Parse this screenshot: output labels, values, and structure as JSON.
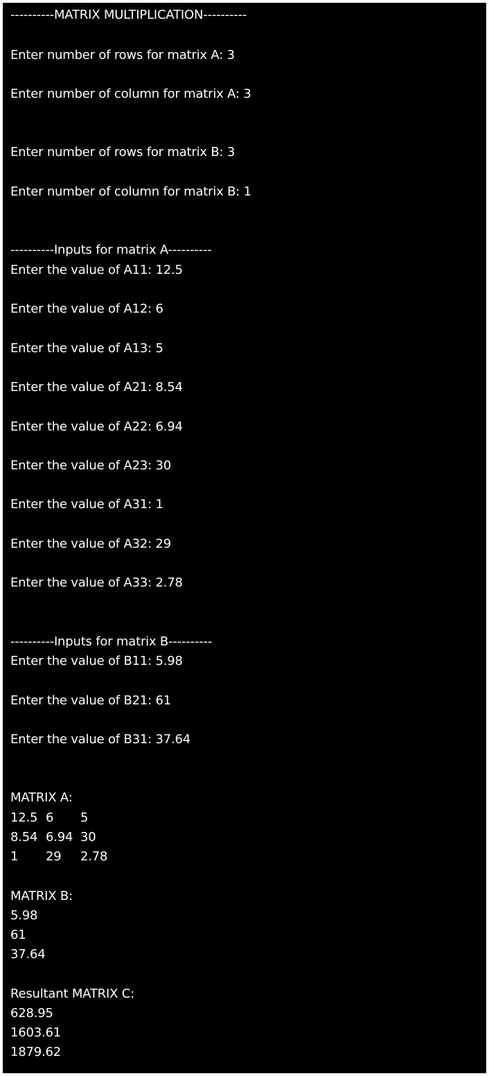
{
  "header": "----------MATRIX MULTIPLICATION----------",
  "prompts": {
    "rows_a": "Enter number of rows for matrix A: 3",
    "cols_a": "Enter number of column for matrix A: 3",
    "rows_b": "Enter number of rows for matrix B: 3",
    "cols_b": "Enter number of column for matrix B: 1"
  },
  "inputs_a": {
    "header": "----------Inputs for matrix A----------",
    "lines": [
      "Enter the value of A11: 12.5",
      "Enter the value of A12: 6",
      "Enter the value of A13: 5",
      "Enter the value of A21: 8.54",
      "Enter the value of A22: 6.94",
      "Enter the value of A23: 30",
      "Enter the value of A31: 1",
      "Enter the value of A32: 29",
      "Enter the value of A33: 2.78"
    ]
  },
  "inputs_b": {
    "header": "----------Inputs for matrix B----------",
    "lines": [
      "Enter the value of B11: 5.98",
      "Enter the value of B21: 61",
      "Enter the value of B31: 37.64"
    ]
  },
  "matrix_a": {
    "label": "MATRIX A:",
    "rows": [
      [
        "12.5",
        "6",
        "5"
      ],
      [
        "8.54",
        "6.94",
        "30"
      ],
      [
        "1",
        "29",
        "2.78"
      ]
    ]
  },
  "matrix_b": {
    "label": "MATRIX B:",
    "rows": [
      "5.98",
      "61",
      "37.64"
    ]
  },
  "matrix_c": {
    "label": "Resultant MATRIX C:",
    "rows": [
      "628.95",
      "1603.61",
      "1879.62"
    ]
  }
}
